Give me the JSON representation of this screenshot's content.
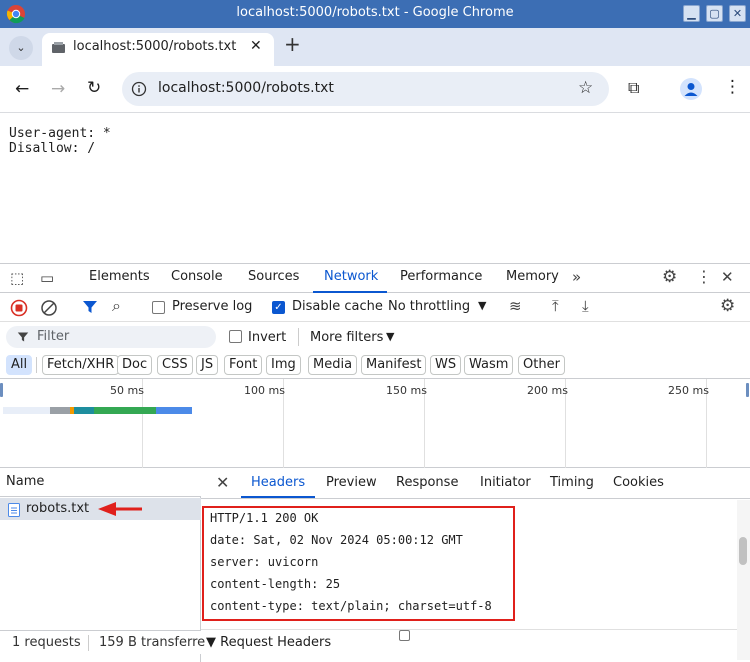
{
  "window": {
    "title": "localhost:5000/robots.txt - Google Chrome",
    "buttons": {
      "minimize": "▢",
      "maximize": "□",
      "close": "✕"
    }
  },
  "tab": {
    "title": "localhost:5000/robots.txt"
  },
  "omnibox": {
    "url": "localhost:5000/robots.txt"
  },
  "page": {
    "content": "User-agent: *\nDisallow: /"
  },
  "devtools": {
    "tabs": [
      "Elements",
      "Console",
      "Sources",
      "Network",
      "Performance",
      "Memory"
    ],
    "active_tab": "Network",
    "toolbar": {
      "preserve_log": "Preserve log",
      "preserve_log_checked": false,
      "disable_cache": "Disable cache",
      "disable_cache_checked": true,
      "throttling": "No throttling"
    },
    "filter": {
      "placeholder": "Filter",
      "invert": "Invert",
      "more_filters": "More filters"
    },
    "type_chips": [
      "All",
      "Fetch/XHR",
      "Doc",
      "CSS",
      "JS",
      "Font",
      "Img",
      "Media",
      "Manifest",
      "WS",
      "Wasm",
      "Other"
    ],
    "active_chip": "All",
    "timeline": {
      "ticks": [
        "50 ms",
        "100 ms",
        "150 ms",
        "200 ms",
        "250 ms"
      ]
    },
    "requests": {
      "header": "Name",
      "rows": [
        {
          "name": "robots.txt"
        }
      ],
      "status": {
        "requests": "1 requests",
        "transferred": "159 B transferre"
      }
    },
    "details": {
      "tabs": [
        "Headers",
        "Preview",
        "Response",
        "Initiator",
        "Timing",
        "Cookies"
      ],
      "active_tab": "Headers",
      "response_headers": [
        "HTTP/1.1 200 OK",
        "date: Sat, 02 Nov 2024 05:00:12 GMT",
        "server: uvicorn",
        "content-length: 25",
        "content-type: text/plain; charset=utf-8"
      ],
      "request_headers_label": "▼ Request Headers"
    }
  },
  "colors": {
    "titlebar": "#3c6eb4",
    "accent": "#0b57d0",
    "highlight_box": "#e0201b"
  }
}
